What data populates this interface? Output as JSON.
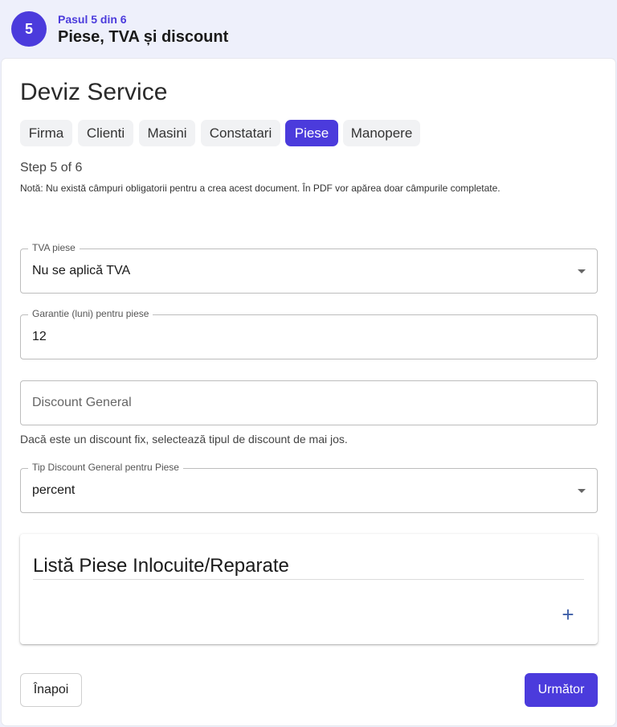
{
  "header": {
    "step_number": "5",
    "step_kicker": "Pasul 5 din 6",
    "step_title": "Piese, TVA și discount"
  },
  "document": {
    "title": "Deviz Service"
  },
  "tabs": [
    {
      "label": "Firma",
      "active": false
    },
    {
      "label": "Clienti",
      "active": false
    },
    {
      "label": "Masini",
      "active": false
    },
    {
      "label": "Constatari",
      "active": false
    },
    {
      "label": "Piese",
      "active": true
    },
    {
      "label": "Manopere",
      "active": false
    }
  ],
  "step_info": "Step 5 of 6",
  "note": "Notă: Nu există câmpuri obligatorii pentru a crea acest document. În PDF vor apărea doar câmpurile completate.",
  "fields": {
    "tva": {
      "label": "TVA piese",
      "value": "Nu se aplică TVA"
    },
    "warranty": {
      "label": "Garantie (luni) pentru piese",
      "value": "12"
    },
    "discount": {
      "placeholder": "Discount General",
      "value": ""
    },
    "discount_helper": "Dacă este un discount fix, selectează tipul de discount de mai jos.",
    "discount_type": {
      "label": "Tip Discount General pentru Piese",
      "value": "percent"
    }
  },
  "parts_section": {
    "title": "Listă Piese Inlocuite/Reparate",
    "add_icon": "plus-icon",
    "add_symbol": "+"
  },
  "footer": {
    "back_label": "Înapoi",
    "next_label": "Următor"
  },
  "colors": {
    "accent": "#4b3bdc",
    "banner_bg": "#eef0fb",
    "tab_bg": "#f1f2f4",
    "plus": "#3f5fa8"
  }
}
